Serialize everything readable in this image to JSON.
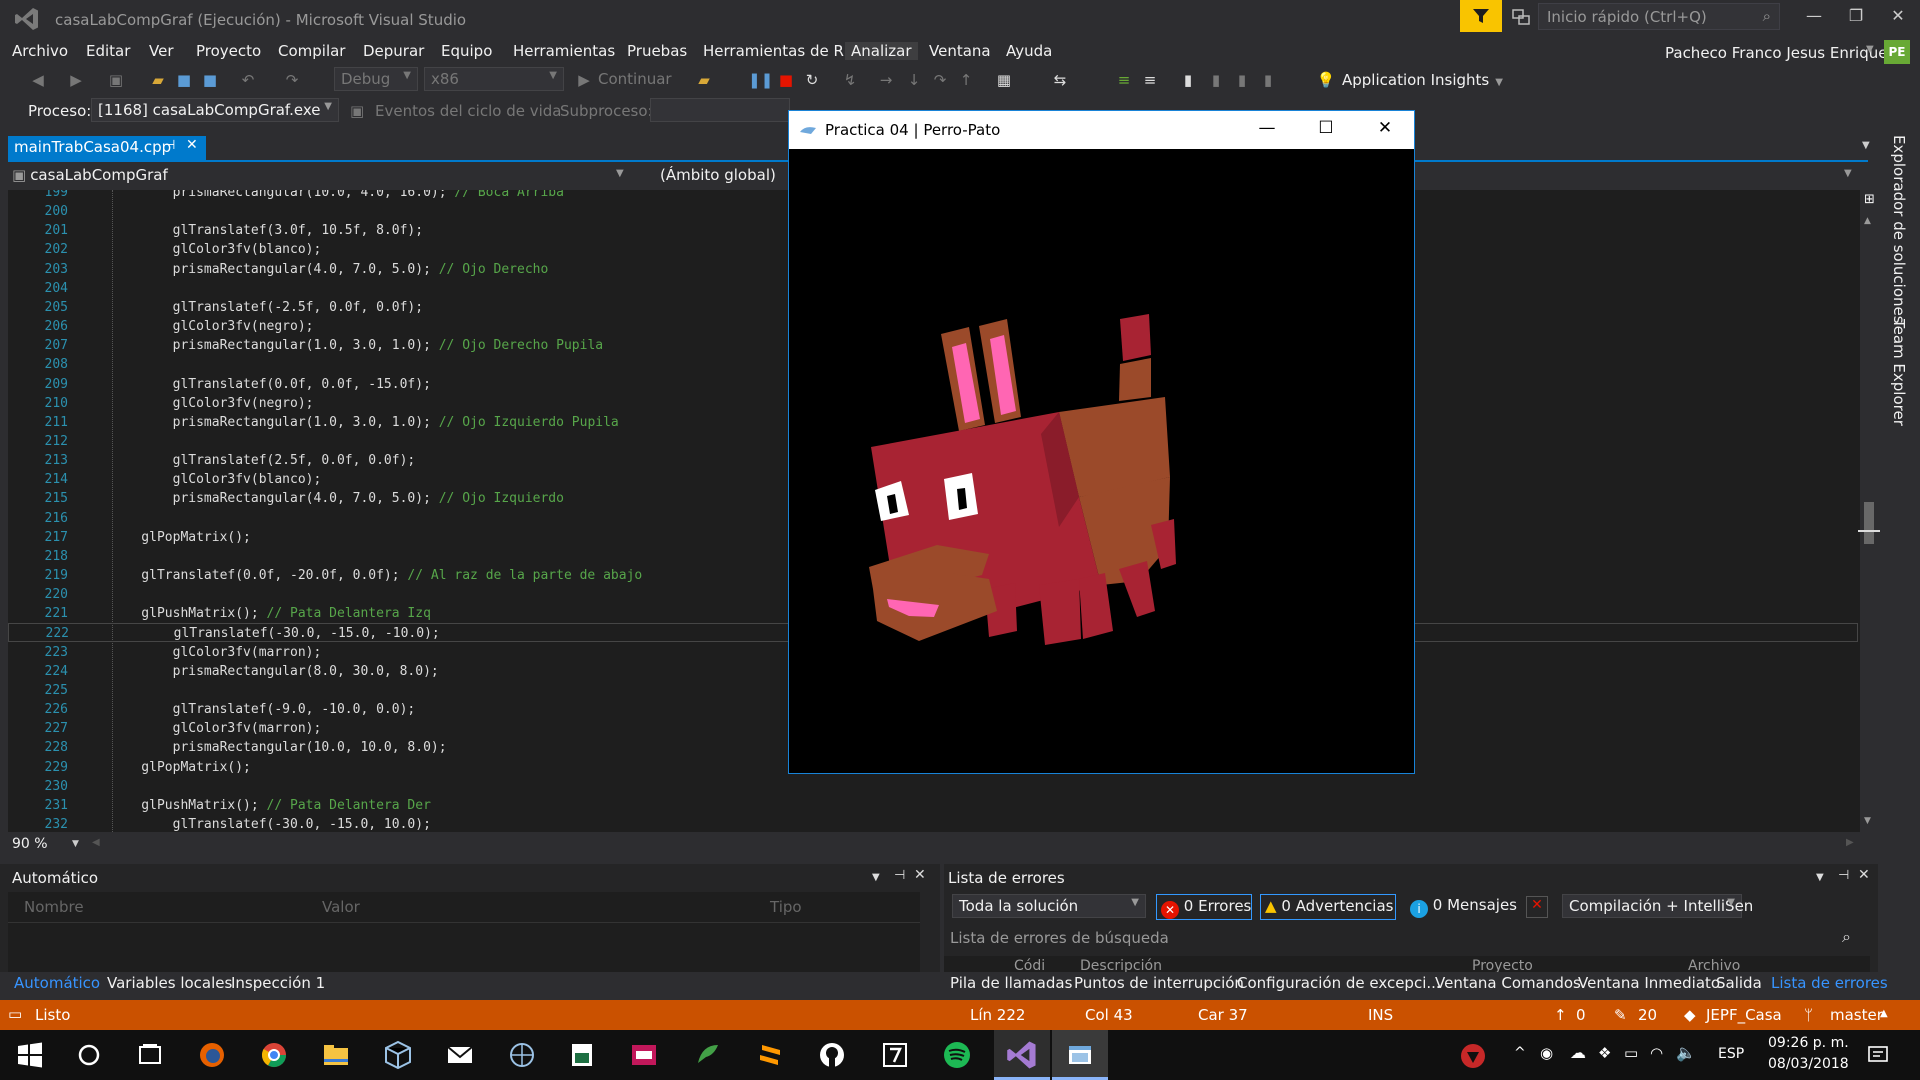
{
  "window": {
    "title": "casaLabCompGraf (Ejecución) - Microsoft Visual Studio",
    "quick_launch_placeholder": "Inicio rápido (Ctrl+Q)",
    "user_name": "Pacheco Franco Jesus Enrique",
    "user_initials": "PE"
  },
  "menu": [
    "Archivo",
    "Editar",
    "Ver",
    "Proyecto",
    "Compilar",
    "Depurar",
    "Equipo",
    "Herramientas",
    "Pruebas",
    "Herramientas de R",
    "Analizar",
    "Ventana",
    "Ayuda"
  ],
  "toolbar": {
    "config": "Debug",
    "platform": "x86",
    "continue_label": "Continuar",
    "app_insights": "Application Insights"
  },
  "process_bar": {
    "process_label": "Proceso:",
    "process_value": "[1168] casaLabCompGraf.exe",
    "lifecycle_label": "Eventos del ciclo de vida",
    "thread_label": "Subproceso:"
  },
  "editor": {
    "tab_name": "mainTrabCasa04.cpp",
    "project_nav": "casaLabCompGraf",
    "scope_nav": "(Ámbito global)",
    "zoom": "90 %",
    "current_line": 222,
    "lines": [
      {
        "n": "199",
        "code": "        prismaRectangular(10.0, 4.0, 16.0); ",
        "comment": "// Boca Arriba"
      },
      {
        "n": "200",
        "code": "",
        "comment": ""
      },
      {
        "n": "201",
        "code": "        glTranslatef(3.0f, 10.5f, 8.0f);",
        "comment": ""
      },
      {
        "n": "202",
        "code": "        glColor3fv(blanco);",
        "comment": ""
      },
      {
        "n": "203",
        "code": "        prismaRectangular(4.0, 7.0, 5.0); ",
        "comment": "// Ojo Derecho"
      },
      {
        "n": "204",
        "code": "",
        "comment": ""
      },
      {
        "n": "205",
        "code": "        glTranslatef(-2.5f, 0.0f, 0.0f);",
        "comment": ""
      },
      {
        "n": "206",
        "code": "        glColor3fv(negro);",
        "comment": ""
      },
      {
        "n": "207",
        "code": "        prismaRectangular(1.0, 3.0, 1.0); ",
        "comment": "// Ojo Derecho Pupila"
      },
      {
        "n": "208",
        "code": "",
        "comment": ""
      },
      {
        "n": "209",
        "code": "        glTranslatef(0.0f, 0.0f, -15.0f);",
        "comment": ""
      },
      {
        "n": "210",
        "code": "        glColor3fv(negro);",
        "comment": ""
      },
      {
        "n": "211",
        "code": "        prismaRectangular(1.0, 3.0, 1.0); ",
        "comment": "// Ojo Izquierdo Pupila"
      },
      {
        "n": "212",
        "code": "",
        "comment": ""
      },
      {
        "n": "213",
        "code": "        glTranslatef(2.5f, 0.0f, 0.0f);",
        "comment": ""
      },
      {
        "n": "214",
        "code": "        glColor3fv(blanco);",
        "comment": ""
      },
      {
        "n": "215",
        "code": "        prismaRectangular(4.0, 7.0, 5.0); ",
        "comment": "// Ojo Izquierdo"
      },
      {
        "n": "216",
        "code": "",
        "comment": ""
      },
      {
        "n": "217",
        "code": "    glPopMatrix();",
        "comment": ""
      },
      {
        "n": "218",
        "code": "",
        "comment": ""
      },
      {
        "n": "219",
        "code": "    glTranslatef(0.0f, -20.0f, 0.0f); ",
        "comment": "// Al raz de la parte de abajo"
      },
      {
        "n": "220",
        "code": "",
        "comment": ""
      },
      {
        "n": "221",
        "code": "    glPushMatrix(); ",
        "comment": "// Pata Delantera Izq"
      },
      {
        "n": "222",
        "code": "        glTranslatef(-30.0, -15.0, -10.0);",
        "comment": ""
      },
      {
        "n": "223",
        "code": "        glColor3fv(marron);",
        "comment": ""
      },
      {
        "n": "224",
        "code": "        prismaRectangular(8.0, 30.0, 8.0);",
        "comment": ""
      },
      {
        "n": "225",
        "code": "",
        "comment": ""
      },
      {
        "n": "226",
        "code": "        glTranslatef(-9.0, -10.0, 0.0);",
        "comment": ""
      },
      {
        "n": "227",
        "code": "        glColor3fv(marron);",
        "comment": ""
      },
      {
        "n": "228",
        "code": "        prismaRectangular(10.0, 10.0, 8.0);",
        "comment": ""
      },
      {
        "n": "229",
        "code": "    glPopMatrix();",
        "comment": ""
      },
      {
        "n": "230",
        "code": "",
        "comment": ""
      },
      {
        "n": "231",
        "code": "    glPushMatrix(); ",
        "comment": "// Pata Delantera Der"
      },
      {
        "n": "232",
        "code": "        glTranslatef(-30.0, -15.0, 10.0);",
        "comment": ""
      }
    ]
  },
  "app_window": {
    "title": "Practica 04 | Perro-Pato"
  },
  "auto_panel": {
    "title": "Automático",
    "col_name": "Nombre",
    "col_value": "Valor",
    "col_type": "Tipo",
    "tabs": [
      "Automático",
      "Variables locales",
      "Inspección 1"
    ]
  },
  "error_panel": {
    "title": "Lista de errores",
    "scope": "Toda la solución",
    "errors": "0 Errores",
    "warnings": "0 Advertencias",
    "messages": "0 Mensajes",
    "build_filter": "Compilación + IntelliSen",
    "search_placeholder": "Lista de errores de búsqueda",
    "col_code": "Códi",
    "col_desc": "Descripción",
    "col_project": "Proyecto",
    "col_file": "Archivo",
    "tabs": [
      "Pila de llamadas",
      "Puntos de interrupción",
      "Configuración de excepci...",
      "Ventana Comandos",
      "Ventana Inmediato",
      "Salida",
      "Lista de errores"
    ]
  },
  "side_tabs": [
    "Explorador de soluciones",
    "Team Explorer"
  ],
  "statusbar": {
    "status": "Listo",
    "line": "Lín 222",
    "col": "Col 43",
    "car": "Car 37",
    "mode": "INS",
    "up": "0",
    "edits": "20",
    "repo": "JEPF_Casa",
    "branch": "master"
  },
  "taskbar": {
    "lang": "ESP",
    "time": "09:26 p. m.",
    "date": "08/03/2018"
  },
  "colors": {
    "accent": "#007acc",
    "status": "#ca5100",
    "body_red": "#a82333",
    "body_brown": "#9b4a2a",
    "pink": "#ff66b3"
  }
}
